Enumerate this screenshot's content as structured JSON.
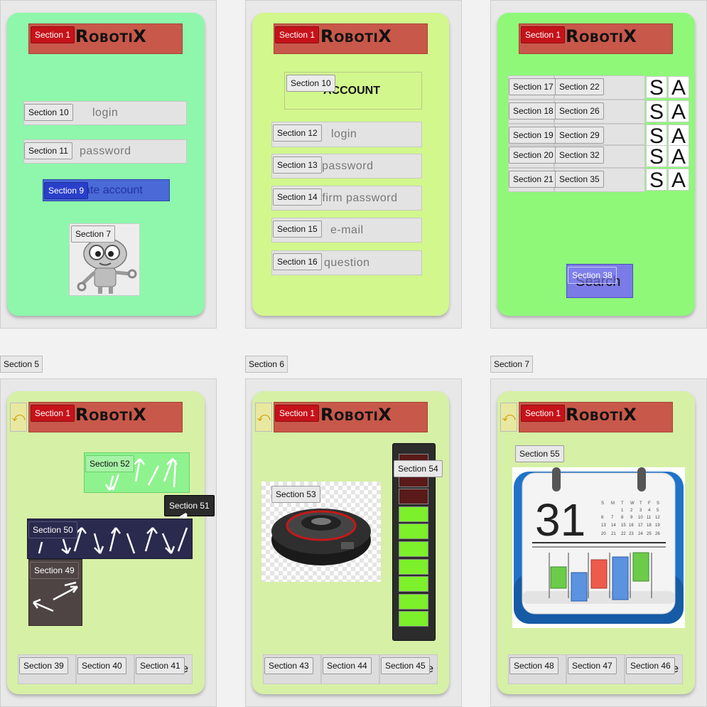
{
  "app": {
    "logo": "RobotiX"
  },
  "screen1": {
    "header_tag": "Section 1",
    "login_tag": "Section 10",
    "login_placeholder": "login",
    "password_tag": "Section 11",
    "password_placeholder": "password",
    "create_tag": "Section 9",
    "create_text": "ate account",
    "image_tag": "Section 7"
  },
  "screen2": {
    "header_tag": "Section 1",
    "account_tag": "Section 10",
    "account_text": "ACCOUNT",
    "fields": [
      {
        "tag": "Section 12",
        "text": "login"
      },
      {
        "tag": "Section 13",
        "text": "password"
      },
      {
        "tag": "Section 14",
        "text": "nfirm password"
      },
      {
        "tag": "Section 15",
        "text": "e-mail"
      },
      {
        "tag": "Section 16",
        "text": "question"
      }
    ]
  },
  "screen3": {
    "header_tag": "Section 1",
    "rows": [
      {
        "left": "Section 17",
        "right": "Section 22"
      },
      {
        "left": "Section 18",
        "right": "Section 26"
      },
      {
        "left": "Section 19",
        "right": "Section 29"
      },
      {
        "left": "Section 20",
        "right": "Section 32"
      },
      {
        "left": "Section 21",
        "right": "Section 35"
      }
    ],
    "letter_s": "S",
    "letter_a": "A",
    "search_tag": "Section 38",
    "search_text": "Search"
  },
  "labels": {
    "s5": "Section 5",
    "s6": "Section 6",
    "s7": "Section 7"
  },
  "screen5": {
    "header_tag": "Section 1",
    "back_icon": "undo-icon",
    "s52": "Section 52",
    "s51": "Section 51",
    "s50": "Section 50",
    "s49": "Section 49",
    "footer": [
      {
        "tag": "Section 39"
      },
      {
        "tag": "Section 40"
      },
      {
        "tag": "Section 41",
        "suffix": "e"
      }
    ]
  },
  "screen6": {
    "header_tag": "Section 1",
    "s53": "Section 53",
    "s54": "Section 54",
    "battery_level": 0.72,
    "footer": [
      {
        "tag": "Section 43"
      },
      {
        "tag": "Section 44"
      },
      {
        "tag": "Section 45",
        "suffix": "e"
      }
    ]
  },
  "screen7": {
    "header_tag": "Section 1",
    "s55": "Section 55",
    "calendar_day": "31",
    "weekdays": [
      "S",
      "M",
      "T",
      "W",
      "T",
      "F",
      "S"
    ],
    "footer": [
      {
        "tag": "Section 48"
      },
      {
        "tag": "Section 47"
      },
      {
        "tag": "Section 46",
        "suffix": "e"
      }
    ]
  },
  "colors": {
    "header": "#c8584a",
    "tag_red": "#c6121a",
    "accent_blue": "#2a3fc9"
  }
}
